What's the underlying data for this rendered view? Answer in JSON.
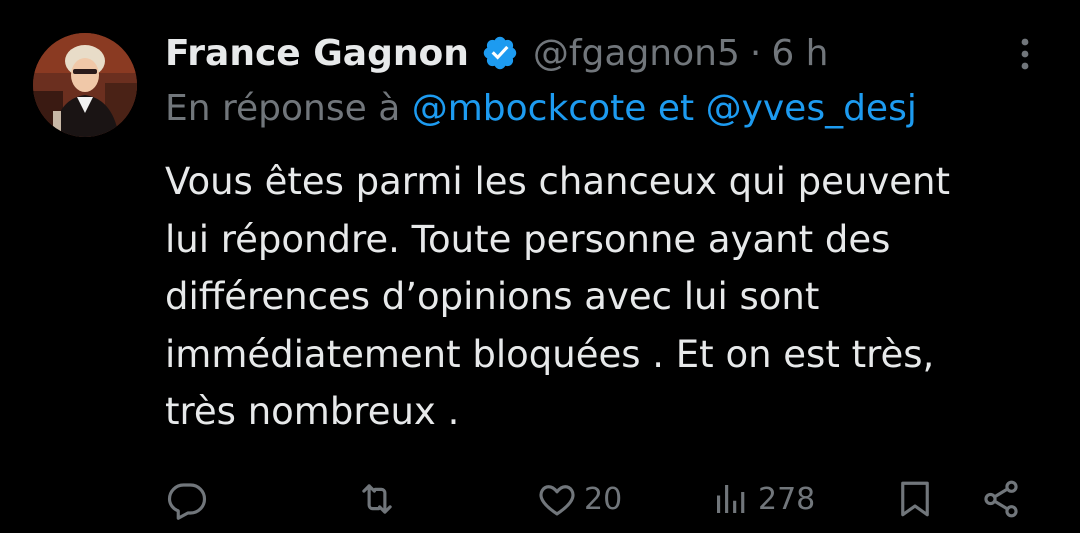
{
  "tweet": {
    "display_name": "France Gagnon",
    "handle": "@fgagnon5",
    "separator": "·",
    "time": "6 h",
    "reply_prefix": "En réponse à",
    "reply_mention_1": "@mbockcote",
    "reply_conjunction": "et",
    "reply_mention_2": "@yves_desj",
    "body_lines": [
      "Vous êtes parmi les chanceux qui peuvent",
      "lui répondre. Toute personne ayant des",
      "différences d’opinions avec lui sont",
      "immédiatement bloquées . Et on est très,",
      "très nombreux ."
    ]
  },
  "actions": {
    "reply_icon": "reply-icon",
    "retweet_icon": "retweet-icon",
    "like_icon": "heart-icon",
    "like_count": "20",
    "views_icon": "bar-chart-icon",
    "views_count": "278",
    "bookmark_icon": "bookmark-icon",
    "share_icon": "share-icon"
  },
  "colors": {
    "background": "#000000",
    "primary_text": "#e7e9ea",
    "secondary_text": "#71767b",
    "accent": "#1d9bf0"
  }
}
